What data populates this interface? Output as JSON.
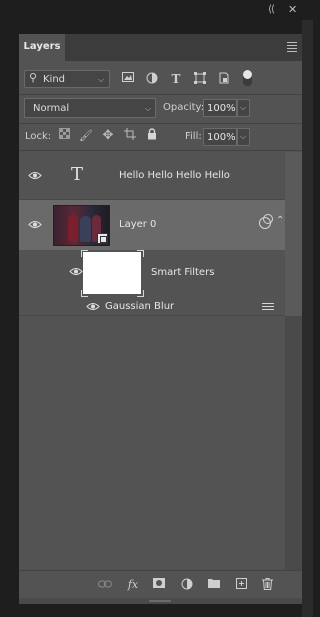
{
  "window": {
    "collapse_icon": "double-chevron-left-icon",
    "close_icon": "close-icon"
  },
  "panel": {
    "tab_label": "Layers",
    "menu_icon": "panel-menu-icon"
  },
  "filter": {
    "kind_label": "Kind",
    "icons": [
      "pixel-layer-filter-icon",
      "adjustment-layer-filter-icon",
      "type-layer-filter-icon",
      "shape-layer-filter-icon",
      "smart-object-filter-icon"
    ],
    "toggle_state": "on"
  },
  "blend": {
    "mode": "Normal",
    "opacity_label": "Opacity:",
    "opacity_value": "100%"
  },
  "lock": {
    "label": "Lock:",
    "icons": [
      "lock-transparent-pixels-icon",
      "lock-image-pixels-icon",
      "lock-position-icon",
      "lock-artboard-icon",
      "lock-all-icon"
    ],
    "fill_label": "Fill:",
    "fill_value": "100%"
  },
  "layers": [
    {
      "name": "Hello Hello Hello Hello",
      "type": "text",
      "visible": true,
      "selected": false
    },
    {
      "name": "Layer 0",
      "type": "smart-object",
      "visible": true,
      "selected": true,
      "smart_filters_label": "Smart Filters",
      "filters": [
        {
          "name": "Gaussian Blur",
          "visible": true
        }
      ]
    }
  ],
  "footer": {
    "icons": [
      "link-layers-icon",
      "fx-icon",
      "add-mask-icon",
      "new-adjustment-layer-icon",
      "new-group-icon",
      "new-layer-icon",
      "delete-layer-icon"
    ],
    "fx_label": "fx"
  }
}
